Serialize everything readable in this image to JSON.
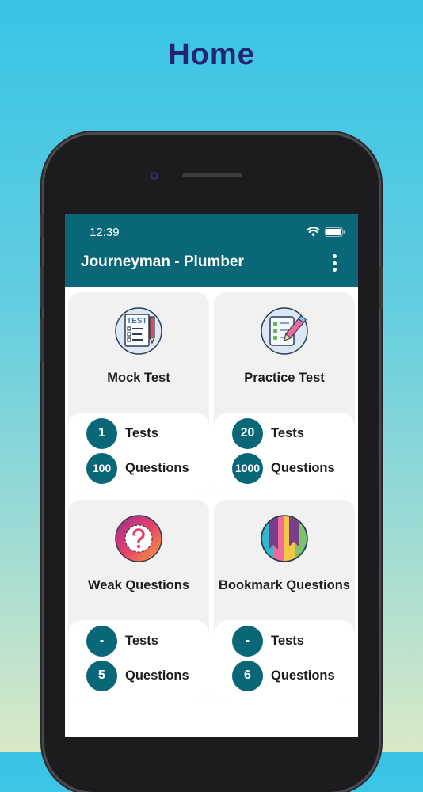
{
  "page_heading": "Home",
  "status_bar": {
    "time": "12:39",
    "signal_dots": "....",
    "wifi_icon": "wifi-icon",
    "battery_icon": "battery-icon"
  },
  "app_bar": {
    "title": "Journeyman - Plumber",
    "menu_icon": "more-vertical-icon"
  },
  "colors": {
    "primary": "#0a6778",
    "heading": "#25246e",
    "card_bg": "#f1f1f2"
  },
  "cards": [
    {
      "title": "Mock Test",
      "icon": "test-sheet-icon",
      "tests_count": "1",
      "tests_label": "Tests",
      "questions_count": "100",
      "questions_label": "Questions"
    },
    {
      "title": "Practice Test",
      "icon": "checklist-pencil-icon",
      "tests_count": "20",
      "tests_label": "Tests",
      "questions_count": "1000",
      "questions_label": "Questions"
    },
    {
      "title": "Weak Questions",
      "icon": "question-badge-icon",
      "tests_count": "-",
      "tests_label": "Tests",
      "questions_count": "5",
      "questions_label": "Questions"
    },
    {
      "title": "Bookmark Questions",
      "icon": "bookmarks-icon",
      "tests_count": "-",
      "tests_label": "Tests",
      "questions_count": "6",
      "questions_label": "Questions"
    }
  ]
}
